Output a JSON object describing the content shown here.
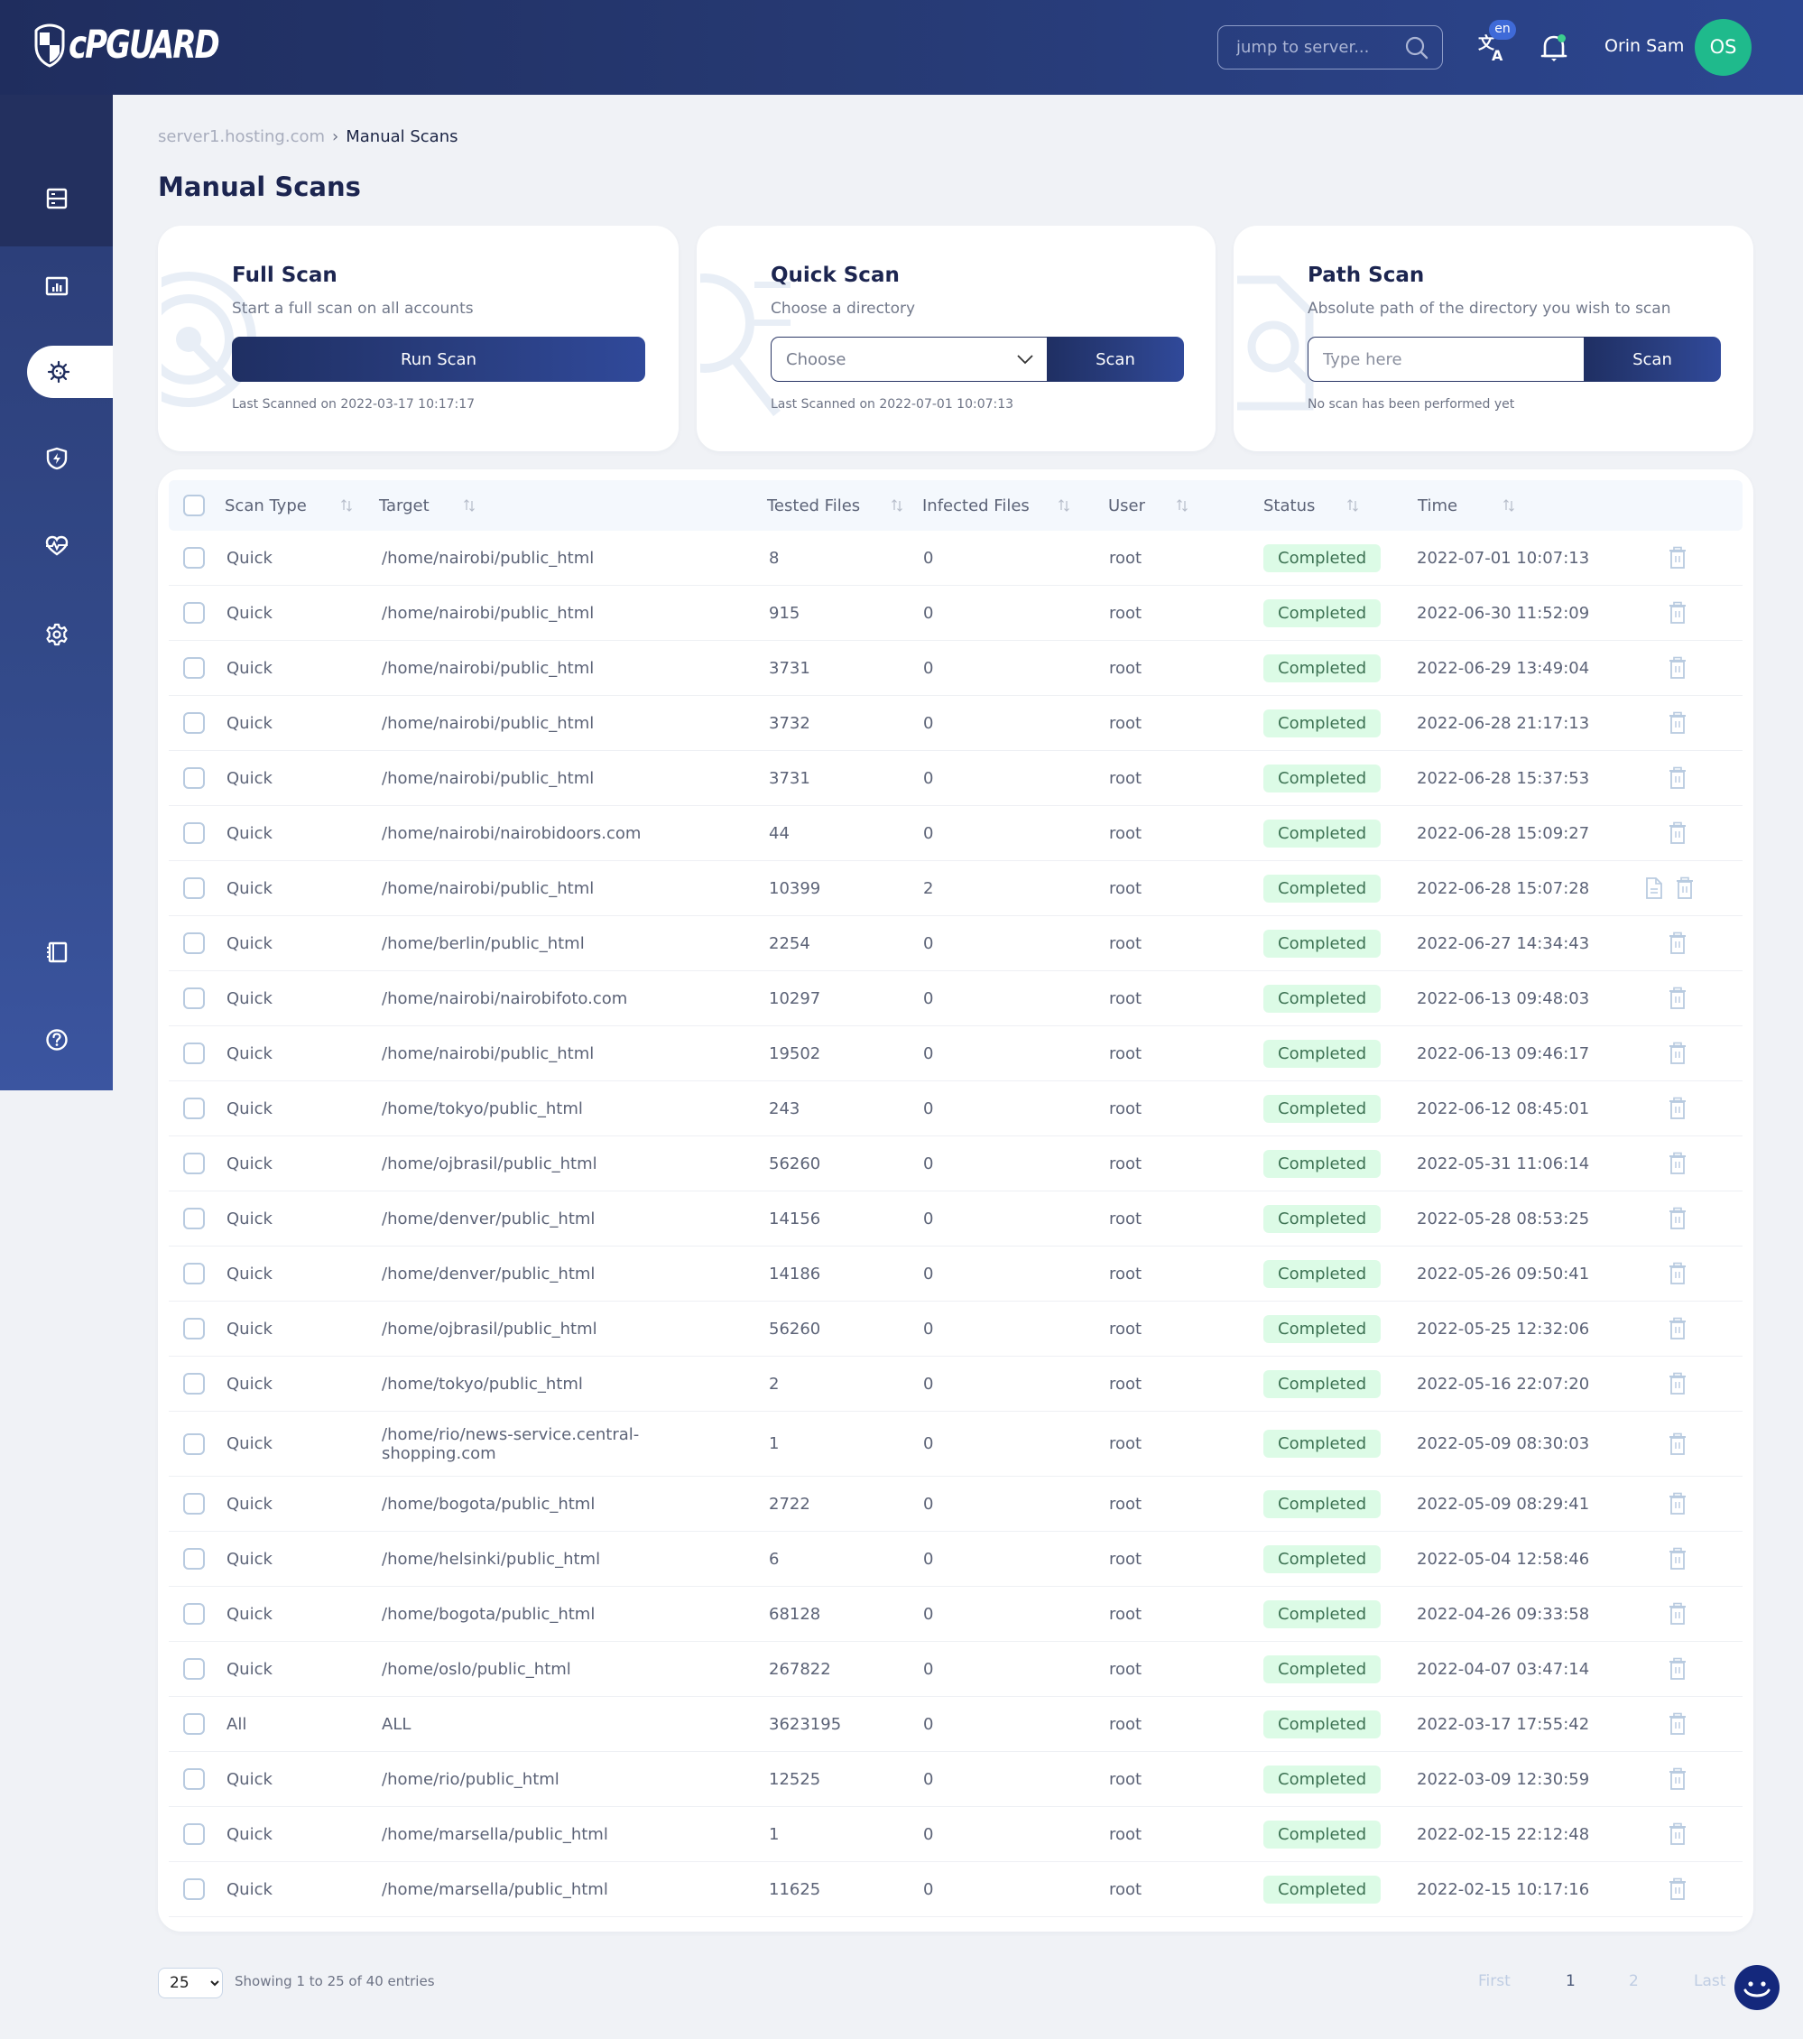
{
  "header": {
    "logo_text": "cPGUARD",
    "search_placeholder": "jump to server...",
    "language_badge": "en",
    "user_name": "Orin Sam",
    "avatar_initials": "OS"
  },
  "sidebar": {
    "items": [
      {
        "id": "servers",
        "icon": "server-icon",
        "active": false
      },
      {
        "id": "reports",
        "icon": "bar-chart-icon",
        "active": false
      },
      {
        "id": "scans",
        "icon": "virus-icon",
        "active": true
      },
      {
        "id": "protection",
        "icon": "shield-bolt-icon",
        "active": false
      },
      {
        "id": "health",
        "icon": "heart-pulse-icon",
        "active": false
      },
      {
        "id": "settings",
        "icon": "gear-icon",
        "active": false
      },
      {
        "id": "docs",
        "icon": "notebook-icon",
        "active": false
      },
      {
        "id": "help",
        "icon": "help-circle-icon",
        "active": false
      }
    ]
  },
  "breadcrumb": {
    "parent": "server1.hosting.com",
    "separator": "›",
    "current": "Manual Scans"
  },
  "page_title": "Manual Scans",
  "cards": {
    "full": {
      "title": "Full Scan",
      "description": "Start a full scan on all accounts",
      "button": "Run Scan",
      "footer": "Last Scanned on 2022-03-17 10:17:17"
    },
    "quick": {
      "title": "Quick Scan",
      "description": "Choose a directory",
      "select_value": "Choose",
      "button": "Scan",
      "footer": "Last Scanned on 2022-07-01 10:07:13"
    },
    "path": {
      "title": "Path Scan",
      "description": "Absolute path of the directory you wish to scan",
      "input_placeholder": "Type here",
      "button": "Scan",
      "footer": "No scan has been performed yet"
    }
  },
  "table": {
    "columns": [
      "Scan Type",
      "Target",
      "Tested Files",
      "Infected Files",
      "User",
      "Status",
      "Time"
    ],
    "rows": [
      {
        "type": "Quick",
        "target": "/home/nairobi/public_html",
        "tested": "8",
        "infected": "0",
        "user": "root",
        "status": "Completed",
        "time": "2022-07-01 10:07:13",
        "report": false
      },
      {
        "type": "Quick",
        "target": "/home/nairobi/public_html",
        "tested": "915",
        "infected": "0",
        "user": "root",
        "status": "Completed",
        "time": "2022-06-30 11:52:09",
        "report": false
      },
      {
        "type": "Quick",
        "target": "/home/nairobi/public_html",
        "tested": "3731",
        "infected": "0",
        "user": "root",
        "status": "Completed",
        "time": "2022-06-29 13:49:04",
        "report": false
      },
      {
        "type": "Quick",
        "target": "/home/nairobi/public_html",
        "tested": "3732",
        "infected": "0",
        "user": "root",
        "status": "Completed",
        "time": "2022-06-28 21:17:13",
        "report": false
      },
      {
        "type": "Quick",
        "target": "/home/nairobi/public_html",
        "tested": "3731",
        "infected": "0",
        "user": "root",
        "status": "Completed",
        "time": "2022-06-28 15:37:53",
        "report": false
      },
      {
        "type": "Quick",
        "target": "/home/nairobi/nairobidoors.com",
        "tested": "44",
        "infected": "0",
        "user": "root",
        "status": "Completed",
        "time": "2022-06-28 15:09:27",
        "report": false
      },
      {
        "type": "Quick",
        "target": "/home/nairobi/public_html",
        "tested": "10399",
        "infected": "2",
        "user": "root",
        "status": "Completed",
        "time": "2022-06-28 15:07:28",
        "report": true
      },
      {
        "type": "Quick",
        "target": "/home/berlin/public_html",
        "tested": "2254",
        "infected": "0",
        "user": "root",
        "status": "Completed",
        "time": "2022-06-27 14:34:43",
        "report": false
      },
      {
        "type": "Quick",
        "target": "/home/nairobi/nairobifoto.com",
        "tested": "10297",
        "infected": "0",
        "user": "root",
        "status": "Completed",
        "time": "2022-06-13 09:48:03",
        "report": false
      },
      {
        "type": "Quick",
        "target": "/home/nairobi/public_html",
        "tested": "19502",
        "infected": "0",
        "user": "root",
        "status": "Completed",
        "time": "2022-06-13 09:46:17",
        "report": false
      },
      {
        "type": "Quick",
        "target": "/home/tokyo/public_html",
        "tested": "243",
        "infected": "0",
        "user": "root",
        "status": "Completed",
        "time": "2022-06-12 08:45:01",
        "report": false
      },
      {
        "type": "Quick",
        "target": "/home/ojbrasil/public_html",
        "tested": "56260",
        "infected": "0",
        "user": "root",
        "status": "Completed",
        "time": "2022-05-31 11:06:14",
        "report": false
      },
      {
        "type": "Quick",
        "target": "/home/denver/public_html",
        "tested": "14156",
        "infected": "0",
        "user": "root",
        "status": "Completed",
        "time": "2022-05-28 08:53:25",
        "report": false
      },
      {
        "type": "Quick",
        "target": "/home/denver/public_html",
        "tested": "14186",
        "infected": "0",
        "user": "root",
        "status": "Completed",
        "time": "2022-05-26 09:50:41",
        "report": false
      },
      {
        "type": "Quick",
        "target": "/home/ojbrasil/public_html",
        "tested": "56260",
        "infected": "0",
        "user": "root",
        "status": "Completed",
        "time": "2022-05-25 12:32:06",
        "report": false
      },
      {
        "type": "Quick",
        "target": "/home/tokyo/public_html",
        "tested": "2",
        "infected": "0",
        "user": "root",
        "status": "Completed",
        "time": "2022-05-16 22:07:20",
        "report": false
      },
      {
        "type": "Quick",
        "target": "/home/rio/news-service.central-shopping.com",
        "tested": "1",
        "infected": "0",
        "user": "root",
        "status": "Completed",
        "time": "2022-05-09 08:30:03",
        "report": false
      },
      {
        "type": "Quick",
        "target": "/home/bogota/public_html",
        "tested": "2722",
        "infected": "0",
        "user": "root",
        "status": "Completed",
        "time": "2022-05-09 08:29:41",
        "report": false
      },
      {
        "type": "Quick",
        "target": "/home/helsinki/public_html",
        "tested": "6",
        "infected": "0",
        "user": "root",
        "status": "Completed",
        "time": "2022-05-04 12:58:46",
        "report": false
      },
      {
        "type": "Quick",
        "target": "/home/bogota/public_html",
        "tested": "68128",
        "infected": "0",
        "user": "root",
        "status": "Completed",
        "time": "2022-04-26 09:33:58",
        "report": false
      },
      {
        "type": "Quick",
        "target": "/home/oslo/public_html",
        "tested": "267822",
        "infected": "0",
        "user": "root",
        "status": "Completed",
        "time": "2022-04-07 03:47:14",
        "report": false
      },
      {
        "type": "All",
        "target": "ALL",
        "tested": "3623195",
        "infected": "0",
        "user": "root",
        "status": "Completed",
        "time": "2022-03-17 17:55:42",
        "report": false
      },
      {
        "type": "Quick",
        "target": "/home/rio/public_html",
        "tested": "12525",
        "infected": "0",
        "user": "root",
        "status": "Completed",
        "time": "2022-03-09 12:30:59",
        "report": false
      },
      {
        "type": "Quick",
        "target": "/home/marsella/public_html",
        "tested": "1",
        "infected": "0",
        "user": "root",
        "status": "Completed",
        "time": "2022-02-15 22:12:48",
        "report": false
      },
      {
        "type": "Quick",
        "target": "/home/marsella/public_html",
        "tested": "11625",
        "infected": "0",
        "user": "root",
        "status": "Completed",
        "time": "2022-02-15 10:17:16",
        "report": false
      }
    ]
  },
  "colors": {
    "brand_dark": "#1f2d5e",
    "brand": "#2c4690",
    "avatar": "#1fba8c",
    "status_completed_bg": "#dcfbe6",
    "status_completed_text": "#3d7253"
  },
  "footer": {
    "page_size": "25",
    "showing": "Showing 1 to 25 of 40 entries",
    "pagination": {
      "first": "First",
      "pages": [
        "1",
        "2"
      ],
      "current": "1",
      "last": "Last"
    }
  }
}
